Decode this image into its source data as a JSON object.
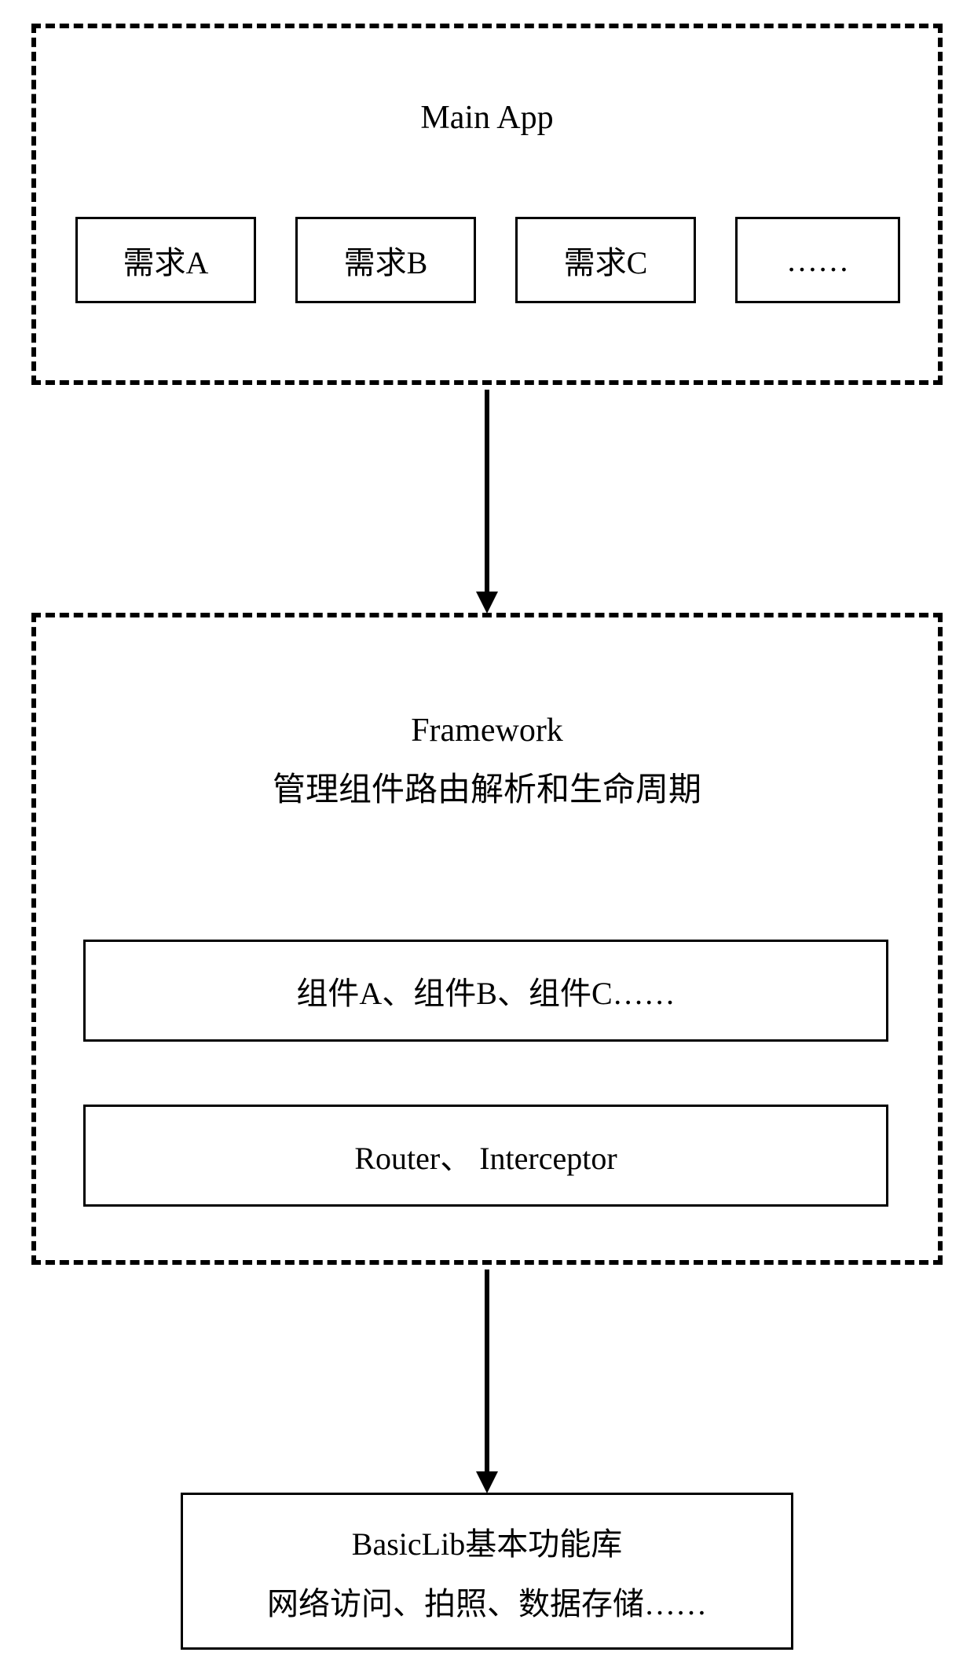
{
  "mainApp": {
    "title": "Main App",
    "boxes": [
      "需求A",
      "需求B",
      "需求C",
      "……"
    ]
  },
  "framework": {
    "title1": "Framework",
    "title2": "管理组件路由解析和生命周期",
    "row1": "组件A、组件B、组件C……",
    "row2": "Router、 Interceptor"
  },
  "basicLib": {
    "line1": "BasicLib基本功能库",
    "line2": "网络访问、拍照、数据存储……"
  }
}
